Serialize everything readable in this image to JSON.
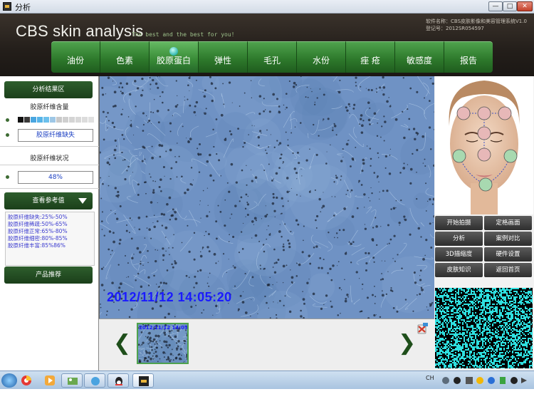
{
  "window": {
    "title": "分析",
    "min_glyph": "—",
    "max_glyph": "□",
    "close_glyph": "✕"
  },
  "header": {
    "logo": "CBS skin analysis",
    "tagline": "The best and the best for you!",
    "software_name": "软件名称：CBS皮肤影像和美容管理系统V1.0",
    "registration": "登记号：2012SR054597"
  },
  "tabs": [
    {
      "label": "油份"
    },
    {
      "label": "色素"
    },
    {
      "label": "胶原蛋白",
      "active": true
    },
    {
      "label": "弹性"
    },
    {
      "label": "毛孔"
    },
    {
      "label": "水份"
    },
    {
      "label": "痤 疮"
    },
    {
      "label": "敏感度"
    },
    {
      "label": "报告"
    }
  ],
  "left_panel": {
    "analysis_header": "分析结果区",
    "collagen_content_label": "胶原纤维含量",
    "swatch_colors": [
      "#111111",
      "#3a3a3a",
      "#4aa6e0",
      "#56b4e8",
      "#6cc0ec",
      "#9ec7e6",
      "#c9c9c9",
      "#cfcfcf",
      "#d4d4d4",
      "#d8d8d8",
      "#dcdcdc",
      "#e0e0e0"
    ],
    "result_value": "胶原纤维缺失",
    "collagen_status_label": "胶原纤维状况",
    "percent_value": "48%",
    "reference_header": "查看参考值",
    "reference_lines": [
      "胶原纤维缺失:25%-50%",
      "胶原纤维稀疏:50%-65%",
      "胶原纤维正常:65%-80%",
      "胶原纤维细密:80%-85%",
      "胶原纤维丰富:85%86%"
    ],
    "product_button": "产品推荐"
  },
  "main": {
    "timestamp": "2012/11/12 14:05:20",
    "thumbnail_timestamp": "2012/11/12 14:05:20",
    "prev_glyph": "❮",
    "next_glyph": "❯"
  },
  "right_panel": {
    "buttons": [
      "开始拍摄",
      "定格画面",
      "分析",
      "案例对比",
      "3D描缩度",
      "硬件设置",
      "皮肤知识",
      "返回首页"
    ]
  },
  "taskbar": {
    "tray_text": "CH",
    "icons": [
      "start-orb-icon",
      "browser-icon",
      "media-player-icon",
      "folder-icon",
      "chat-icon",
      "ie-icon",
      "qq-icon",
      "cbs-app-icon"
    ]
  },
  "colors": {
    "tab_green": "#2e7a2c",
    "header_dark": "#231e1a",
    "button_dark": "#2e2e2e",
    "timestamp_blue": "#1a1aff",
    "face_marker_pink": "#e7b8b8",
    "face_marker_green": "#a8d9b0"
  }
}
